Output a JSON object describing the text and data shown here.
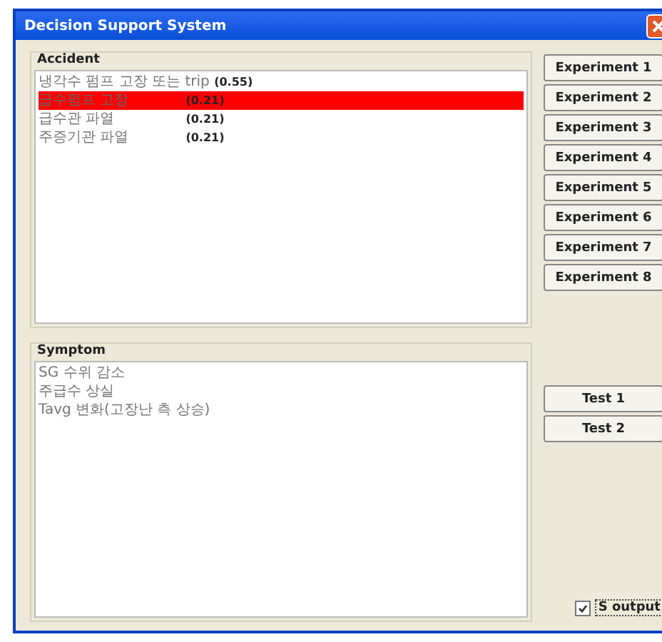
{
  "window": {
    "title": "Decision Support System"
  },
  "accident": {
    "title": "Accident",
    "items": [
      {
        "label": "냉각수 펌프 고장 또는 trip",
        "score": "(0.55)",
        "selected": false
      },
      {
        "label": "급수펌프 고장",
        "score": "(0.21)",
        "selected": true
      },
      {
        "label": "급수관 파열",
        "score": "(0.21)",
        "selected": false
      },
      {
        "label": "주증기관 파열",
        "score": "(0.21)",
        "selected": false
      }
    ]
  },
  "symptom": {
    "title": "Symptom",
    "items": [
      "SG 수위 감소",
      "주급수 상실",
      "Tavg 변화(고장난 측 상승)"
    ]
  },
  "experiment_buttons": [
    "Experiment 1",
    "Experiment 2",
    "Experiment 3",
    "Experiment 4",
    "Experiment 5",
    "Experiment 6",
    "Experiment 7",
    "Experiment 8"
  ],
  "test_buttons": [
    "Test 1",
    "Test 2"
  ],
  "checkbox": {
    "label": "S output",
    "checked": true
  }
}
